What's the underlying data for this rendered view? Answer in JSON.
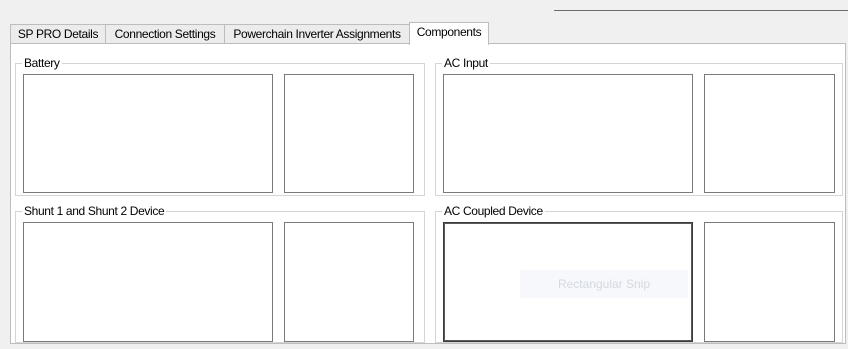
{
  "tabs": [
    {
      "label": "SP PRO Details",
      "active": false
    },
    {
      "label": "Connection Settings",
      "active": false
    },
    {
      "label": "Powerchain Inverter Assignments",
      "active": false
    },
    {
      "label": "Components",
      "active": true
    }
  ],
  "groups": {
    "battery": {
      "title": "Battery"
    },
    "ac_input": {
      "title": "AC Input"
    },
    "shunt": {
      "title": "Shunt 1 and Shunt 2 Device"
    },
    "ac_coupled": {
      "title": "AC Coupled Device"
    }
  },
  "overlay_hint": "Rectangular Snip"
}
